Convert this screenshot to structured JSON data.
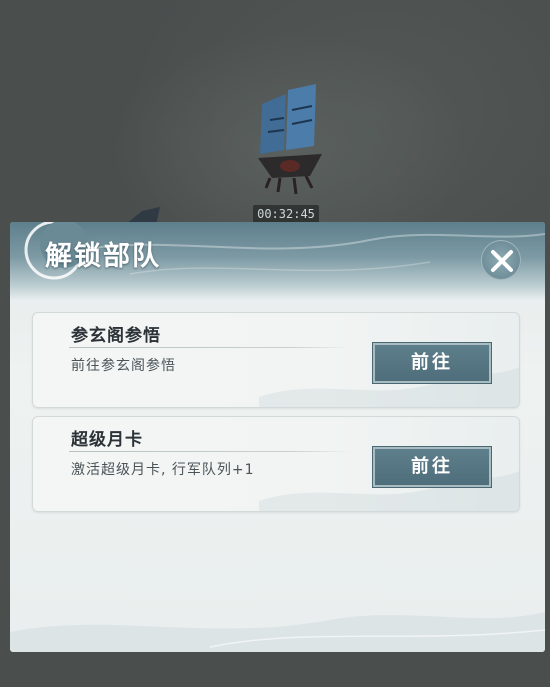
{
  "timer": "00:32:45",
  "dialog": {
    "title": "解锁部队",
    "close_icon": "close-icon"
  },
  "options": [
    {
      "title": "参玄阁参悟",
      "description": "前往参玄阁参悟",
      "button_label": "前往"
    },
    {
      "title": "超级月卡",
      "description": "激活超级月卡, 行军队列+1",
      "button_label": "前往"
    }
  ],
  "colors": {
    "header_accent": "#5d7f8c",
    "button_fill": "#56768a",
    "dialog_bg": "#eef2f1"
  }
}
